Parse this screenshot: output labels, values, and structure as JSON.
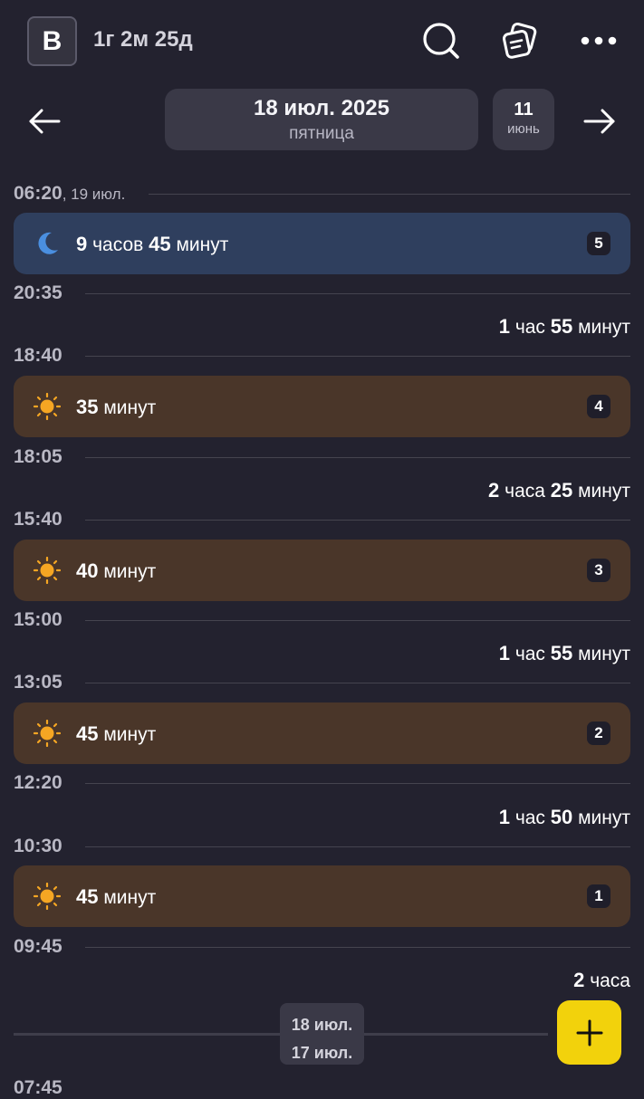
{
  "header": {
    "avatar_letter": "В",
    "age": "1г 2м 25д",
    "icons": [
      "search-icon",
      "notes-icon",
      "more-icon"
    ]
  },
  "date_nav": {
    "date": "18 июл. 2025",
    "weekday": "пятница",
    "month_day": "11",
    "month_name": "июнь",
    "icons": [
      "arrow-left-icon",
      "arrow-right-icon"
    ]
  },
  "timeline": {
    "t1": {
      "time": "06:20",
      "suffix": ", 19 июл."
    },
    "sleep": {
      "hours_num": "9",
      "hours_word": "часов",
      "minutes_num": "45",
      "minutes_word": "минут",
      "badge": "5",
      "icon": "moon-icon"
    },
    "t2": {
      "time": "20:35"
    },
    "gap1": {
      "a_num": "1",
      "a_word": "час",
      "b_num": "55",
      "b_word": "минут"
    },
    "t3": {
      "time": "18:40"
    },
    "nap4": {
      "num": "35",
      "word": "минут",
      "badge": "4",
      "icon": "sun-icon"
    },
    "t4": {
      "time": "18:05"
    },
    "gap2": {
      "a_num": "2",
      "a_word": "часа",
      "b_num": "25",
      "b_word": "минут"
    },
    "t5": {
      "time": "15:40"
    },
    "nap3": {
      "num": "40",
      "word": "минут",
      "badge": "3",
      "icon": "sun-icon"
    },
    "t6": {
      "time": "15:00"
    },
    "gap3": {
      "a_num": "1",
      "a_word": "час",
      "b_num": "55",
      "b_word": "минут"
    },
    "t7": {
      "time": "13:05"
    },
    "nap2": {
      "num": "45",
      "word": "минут",
      "badge": "2",
      "icon": "sun-icon"
    },
    "t8": {
      "time": "12:20"
    },
    "gap4": {
      "a_num": "1",
      "a_word": "час",
      "b_num": "50",
      "b_word": "минут"
    },
    "t9": {
      "time": "10:30"
    },
    "nap1": {
      "num": "45",
      "word": "минут",
      "badge": "1",
      "icon": "sun-icon"
    },
    "t10": {
      "time": "09:45"
    },
    "gap5": {
      "a_num": "2",
      "a_word": "часа"
    },
    "t11": {
      "time": "07:45"
    }
  },
  "bottom": {
    "day_top": "18 июл.",
    "day_bottom": "17 июл.",
    "add_icon": "plus-icon"
  },
  "colors": {
    "background": "#23222f",
    "sleep_card": "#2f3f5e",
    "wake_card": "#4a3629",
    "accent_fab": "#f2d20c",
    "sun": "#f5a623",
    "moon": "#4a8fe0"
  }
}
